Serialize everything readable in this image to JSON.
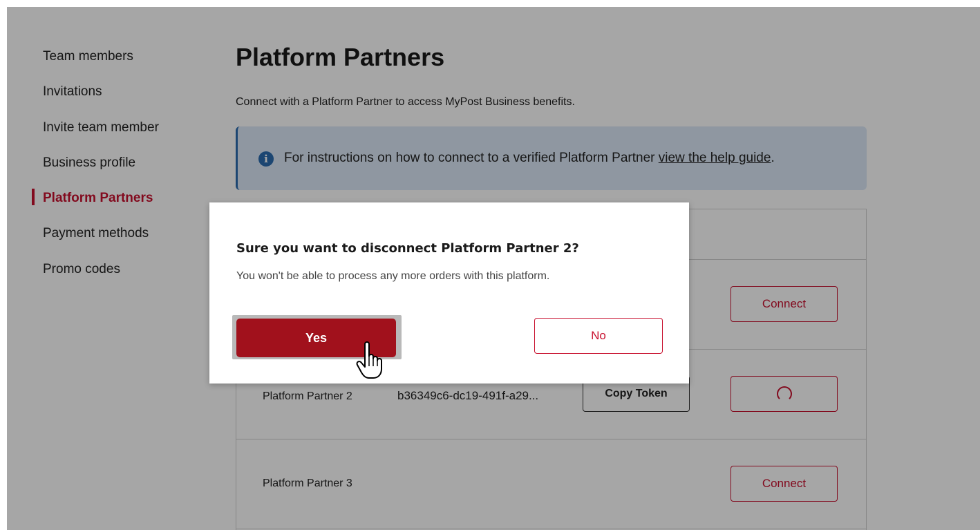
{
  "sidebar": {
    "items": [
      {
        "label": "Team members"
      },
      {
        "label": "Invitations"
      },
      {
        "label": "Invite team member"
      },
      {
        "label": "Business profile"
      },
      {
        "label": "Platform Partners",
        "active": true
      },
      {
        "label": "Payment methods"
      },
      {
        "label": "Promo codes"
      }
    ]
  },
  "main": {
    "title": "Platform Partners",
    "subtitle": "Connect with a Platform Partner to access MyPost Business benefits.",
    "info": {
      "icon": "info-icon",
      "text": "For instructions on how to connect to a verified Platform Partner ",
      "link": "view the help guide",
      "suffix": "."
    },
    "partners": [
      {
        "name": "",
        "action": "Connect"
      },
      {
        "name": "Platform Partner 2",
        "token": "b36349c6-dc19-491f-a29...",
        "copy_label": "Copy Token",
        "action": "loading"
      },
      {
        "name": "Platform Partner 3",
        "action": "Connect"
      }
    ]
  },
  "modal": {
    "title": "Sure you want to disconnect Platform Partner 2?",
    "body": "You won't be able to process any more orders with this platform.",
    "yes_label": "Yes",
    "no_label": "No"
  },
  "colors": {
    "brand_red": "#c8102e",
    "button_red": "#a1111c",
    "info_bg": "#dce9f7",
    "info_accent": "#2b6cb0"
  }
}
